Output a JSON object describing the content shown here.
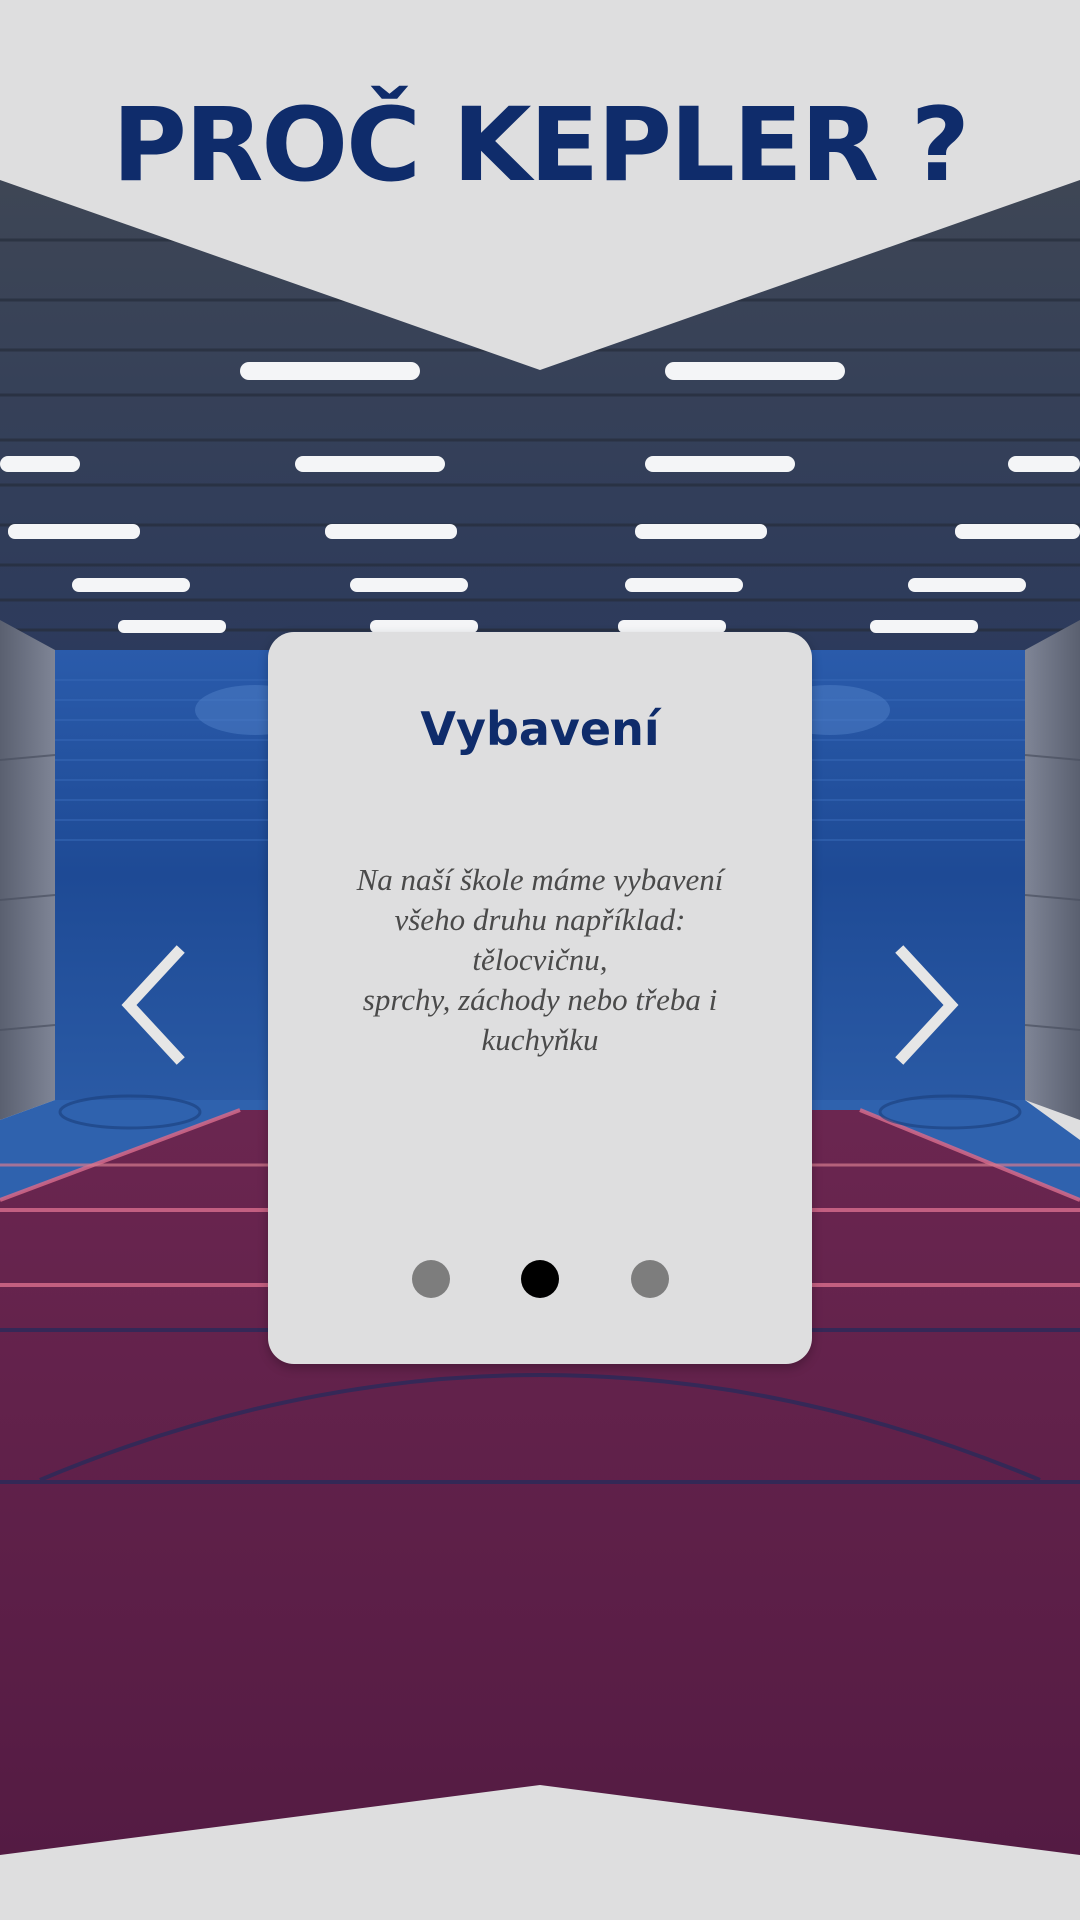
{
  "header": {
    "title": "PROČ KEPLER ?"
  },
  "slide": {
    "title": "Vybavení",
    "text_lines": [
      "Na naší škole máme vybavení",
      "všeho druhu například:",
      "tělocvičnu,",
      "sprchy, záchody nebo třeba i",
      "kuchyňku"
    ]
  },
  "carousel": {
    "slide_count": 3,
    "active_index": 1,
    "prev_icon": "chevron-left-icon",
    "next_icon": "chevron-right-icon"
  },
  "colors": {
    "title": "#0f2c6b",
    "panel": "#dededf",
    "court_floor": "#5c2049",
    "gym_wall": "#1f4a94",
    "dot_inactive": "#7d7d7d",
    "dot_active": "#000000"
  }
}
